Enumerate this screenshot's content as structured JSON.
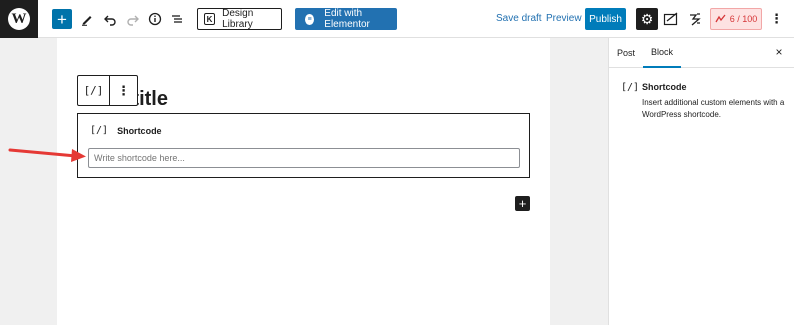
{
  "toolbar": {
    "add_icon": "plus-icon",
    "tools_icon": "pencil-icon",
    "undo_icon": "undo-icon",
    "redo_icon": "redo-icon",
    "details_icon": "info-icon",
    "outline_icon": "list-view-icon",
    "design_library_label": "Design Library",
    "edit_with_elementor_label": "Edit with Elementor",
    "save_draft_label": "Save draft",
    "preview_label": "Preview",
    "publish_label": "Publish",
    "score_label": "6 / 100",
    "brand_color": "#0073aa",
    "score_color": "#d63638"
  },
  "editor": {
    "title_fragment": "Add title",
    "block_type_icon": "[/]",
    "more_options_icon": "⋮",
    "shortcode": {
      "label": "Shortcode",
      "icon": "[/]",
      "placeholder": "Write shortcode here..."
    }
  },
  "sidebar": {
    "tabs": [
      {
        "label": "Post",
        "active": false
      },
      {
        "label": "Block",
        "active": true
      }
    ],
    "close_icon": "×",
    "block_icon": "[/]",
    "block_title": "Shortcode",
    "block_description": "Insert additional custom elements with a WordPress shortcode."
  }
}
